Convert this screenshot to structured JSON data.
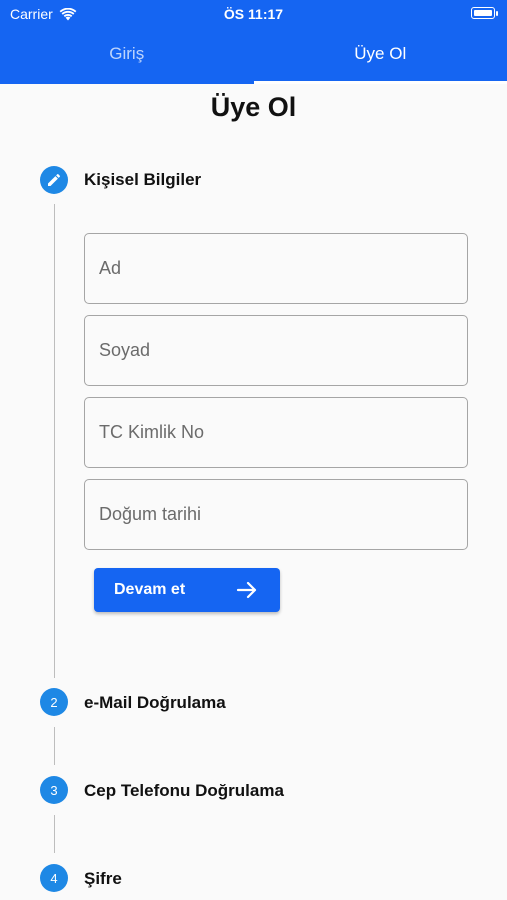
{
  "status_bar": {
    "carrier": "Carrier",
    "time": "ÖS 11:17"
  },
  "tabs": [
    {
      "label": "Giriş",
      "active": false
    },
    {
      "label": "Üye Ol",
      "active": true
    }
  ],
  "page": {
    "title": "Üye Ol"
  },
  "steps": [
    {
      "number": "",
      "icon": "pencil-icon",
      "label": "Kişisel Bilgiler"
    },
    {
      "number": "2",
      "label": "e-Mail Doğrulama"
    },
    {
      "number": "3",
      "label": "Cep Telefonu Doğrulama"
    },
    {
      "number": "4",
      "label": "Şifre"
    }
  ],
  "form": {
    "first_name_placeholder": "Ad",
    "last_name_placeholder": "Soyad",
    "tc_placeholder": "TC Kimlik No",
    "birth_date_placeholder": "Doğum tarihi",
    "continue_label": "Devam et",
    "continue_icon": "arrow-right-icon"
  },
  "colors": {
    "primary": "#1565f2",
    "step_circle": "#1e88e5"
  }
}
